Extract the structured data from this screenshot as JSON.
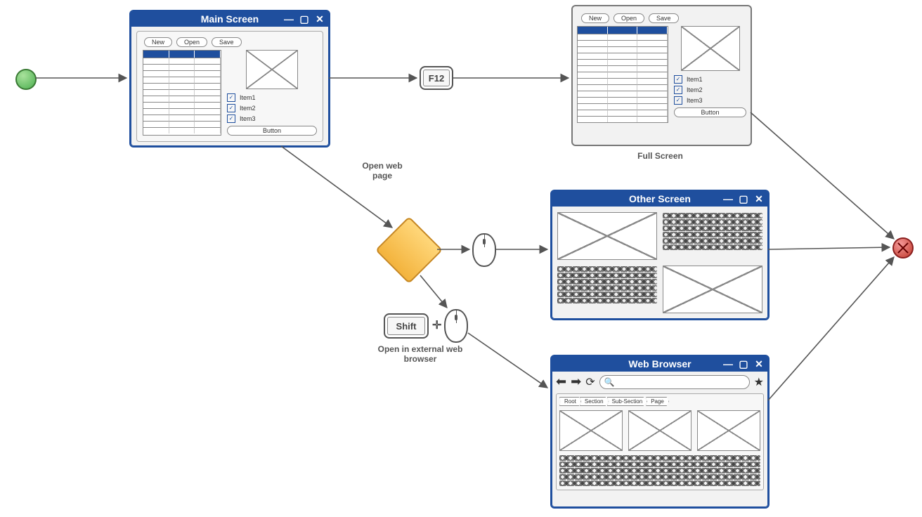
{
  "nodes": {
    "start": {
      "type": "start"
    },
    "end": {
      "type": "end"
    },
    "decision": {
      "type": "decision"
    },
    "main_screen": {
      "title": "Main Screen",
      "toolbar": [
        "New",
        "Open",
        "Save"
      ],
      "checks": [
        "Item1",
        "Item2",
        "Item3"
      ],
      "button": "Button"
    },
    "full_screen": {
      "caption": "Full Screen",
      "toolbar": [
        "New",
        "Open",
        "Save"
      ],
      "checks": [
        "Item1",
        "Item2",
        "Item3"
      ],
      "button": "Button"
    },
    "other_screen": {
      "title": "Other Screen"
    },
    "web_browser": {
      "title": "Web Browser",
      "breadcrumb": [
        "Root",
        "Section",
        "Sub-Section",
        "Page"
      ]
    }
  },
  "edges": {
    "f12_key": "F12",
    "open_web_page": "Open web\npage",
    "shift_key": "Shift",
    "open_external": "Open in external web\nbrowser"
  }
}
